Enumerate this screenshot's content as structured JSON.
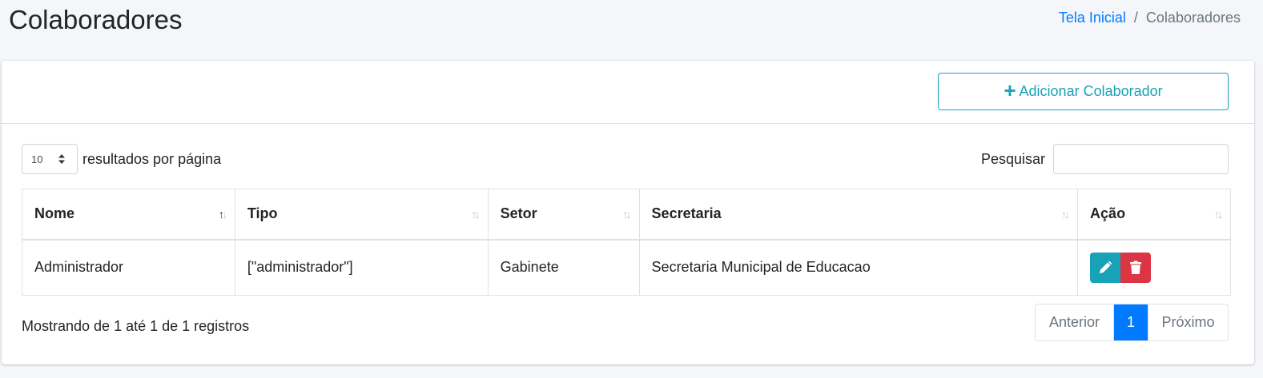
{
  "header": {
    "title": "Colaboradores",
    "breadcrumb": {
      "home": "Tela Inicial",
      "separator": "/",
      "current": "Colaboradores"
    }
  },
  "toolbar": {
    "add_label": "Adicionar Colaborador"
  },
  "controls": {
    "page_length": "10",
    "page_length_label": "resultados por página",
    "search_label": "Pesquisar",
    "search_value": ""
  },
  "table": {
    "columns": [
      "Nome",
      "Tipo",
      "Setor",
      "Secretaria",
      "Ação"
    ],
    "rows": [
      {
        "nome": "Administrador",
        "tipo": "[\"administrador\"]",
        "setor": "Gabinete",
        "secretaria": "Secretaria Municipal de Educacao"
      }
    ]
  },
  "footer": {
    "info": "Mostrando de 1 até 1 de 1 registros",
    "prev_label": "Anterior",
    "current_page": "1",
    "next_label": "Próximo"
  },
  "colors": {
    "accent": "#17a2b8",
    "danger": "#dc3545",
    "primary": "#007bff"
  },
  "icons": {
    "add": "plus-icon",
    "edit": "pencil-icon",
    "delete": "trash-icon",
    "sort": "sort-arrows-icon",
    "select": "caret-up-down-icon"
  }
}
